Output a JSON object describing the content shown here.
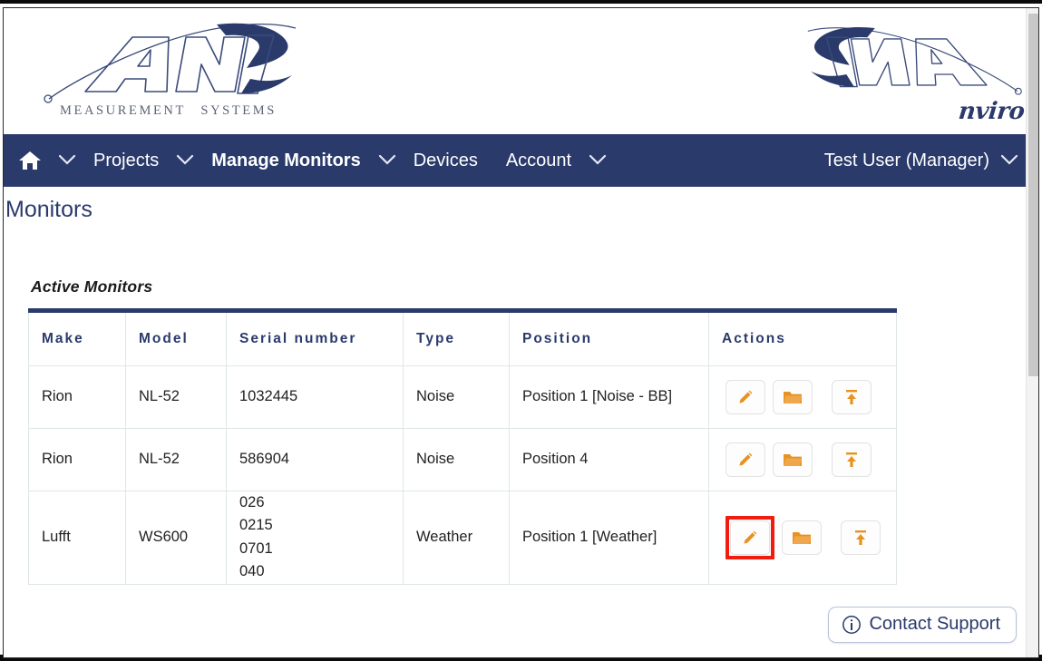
{
  "branding": {
    "left_logo_text": "ANV",
    "left_logo_caption_measurement": "MEASUREMENT",
    "left_logo_caption_systems": "SYSTEMS",
    "right_logo_script": "nviro",
    "navy": "#2a3a6b",
    "accent_orange": "#e8921f",
    "highlight_red": "#f01c10"
  },
  "nav": {
    "home_icon": "home-icon",
    "items": [
      {
        "label": "Projects",
        "active": false,
        "has_chevron": true
      },
      {
        "label": "Manage Monitors",
        "active": true,
        "has_chevron": true
      },
      {
        "label": "Devices",
        "active": false,
        "has_chevron": false
      },
      {
        "label": "Account",
        "active": false,
        "has_chevron": true
      }
    ],
    "user_label": "Test User (Manager)"
  },
  "page": {
    "title": "Monitors",
    "section_title": "Active Monitors"
  },
  "table": {
    "columns": [
      "Make",
      "Model",
      "Serial number",
      "Type",
      "Position",
      "Actions"
    ],
    "rows": [
      {
        "make": "Rion",
        "model": "NL-52",
        "serial": "1032445",
        "type": "Noise",
        "position": "Position 1 [Noise - BB]",
        "highlighted_action": null
      },
      {
        "make": "Rion",
        "model": "NL-52",
        "serial": "586904",
        "type": "Noise",
        "position": "Position 4",
        "highlighted_action": null
      },
      {
        "make": "Lufft",
        "model": "WS600",
        "serial": "026\n0215\n0701\n040",
        "type": "Weather",
        "position": "Position 1 [Weather]",
        "highlighted_action": "edit"
      }
    ],
    "action_icons": [
      "pencil-icon",
      "folder-icon",
      "upload-icon"
    ]
  },
  "support": {
    "label": "Contact Support",
    "icon": "info-icon"
  },
  "scrollbar": {
    "visible": true
  }
}
